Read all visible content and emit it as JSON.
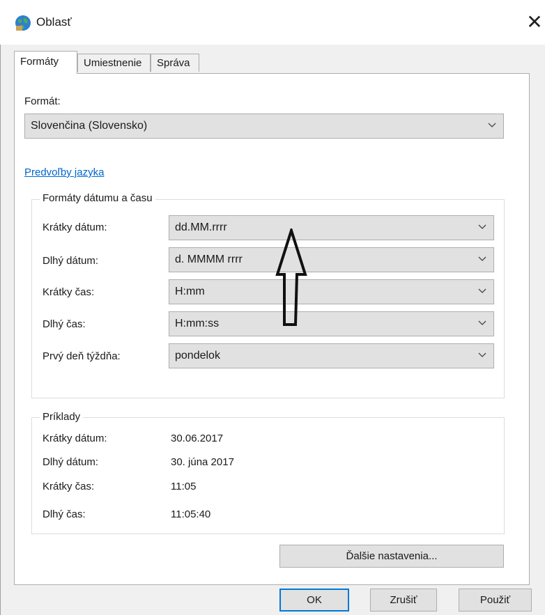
{
  "window": {
    "title": "Oblasť",
    "close_glyph": "✕"
  },
  "tabs": [
    {
      "label": "Formáty",
      "active": true
    },
    {
      "label": "Umiestnenie",
      "active": false
    },
    {
      "label": "Správa",
      "active": false
    }
  ],
  "format": {
    "label": "Formát:",
    "value": "Slovenčina (Slovensko)"
  },
  "language_link": "Predvoľby jazyka",
  "date_time_group": {
    "title": "Formáty dátumu a času",
    "rows": [
      {
        "label": "Krátky dátum:",
        "value": "dd.MM.rrrr"
      },
      {
        "label": "Dlhý dátum:",
        "value": "d. MMMM rrrr"
      },
      {
        "label": "Krátky čas:",
        "value": "H:mm"
      },
      {
        "label": "Dlhý čas:",
        "value": "H:mm:ss"
      },
      {
        "label": "Prvý deň týždňa:",
        "value": "pondelok"
      }
    ]
  },
  "examples_group": {
    "title": "Príklady",
    "rows": [
      {
        "label": "Krátky dátum:",
        "value": "30.06.2017"
      },
      {
        "label": "Dlhý dátum:",
        "value": "30. júna 2017"
      },
      {
        "label": "Krátky čas:",
        "value": "11:05"
      },
      {
        "label": "Dlhý čas:",
        "value": "11:05:40"
      }
    ]
  },
  "buttons": {
    "more_settings": "Ďalšie nastavenia...",
    "ok": "OK",
    "cancel": "Zrušiť",
    "apply": "Použiť"
  },
  "icons": {
    "app": "globe-icon",
    "close": "close-icon",
    "dropdown": "chevron-down-icon",
    "annotation": "arrow-up-annotation"
  },
  "colors": {
    "accent": "#0078d7",
    "link": "#0066cc",
    "panel_bg": "#ffffff",
    "frame_bg": "#f0f0f0"
  }
}
